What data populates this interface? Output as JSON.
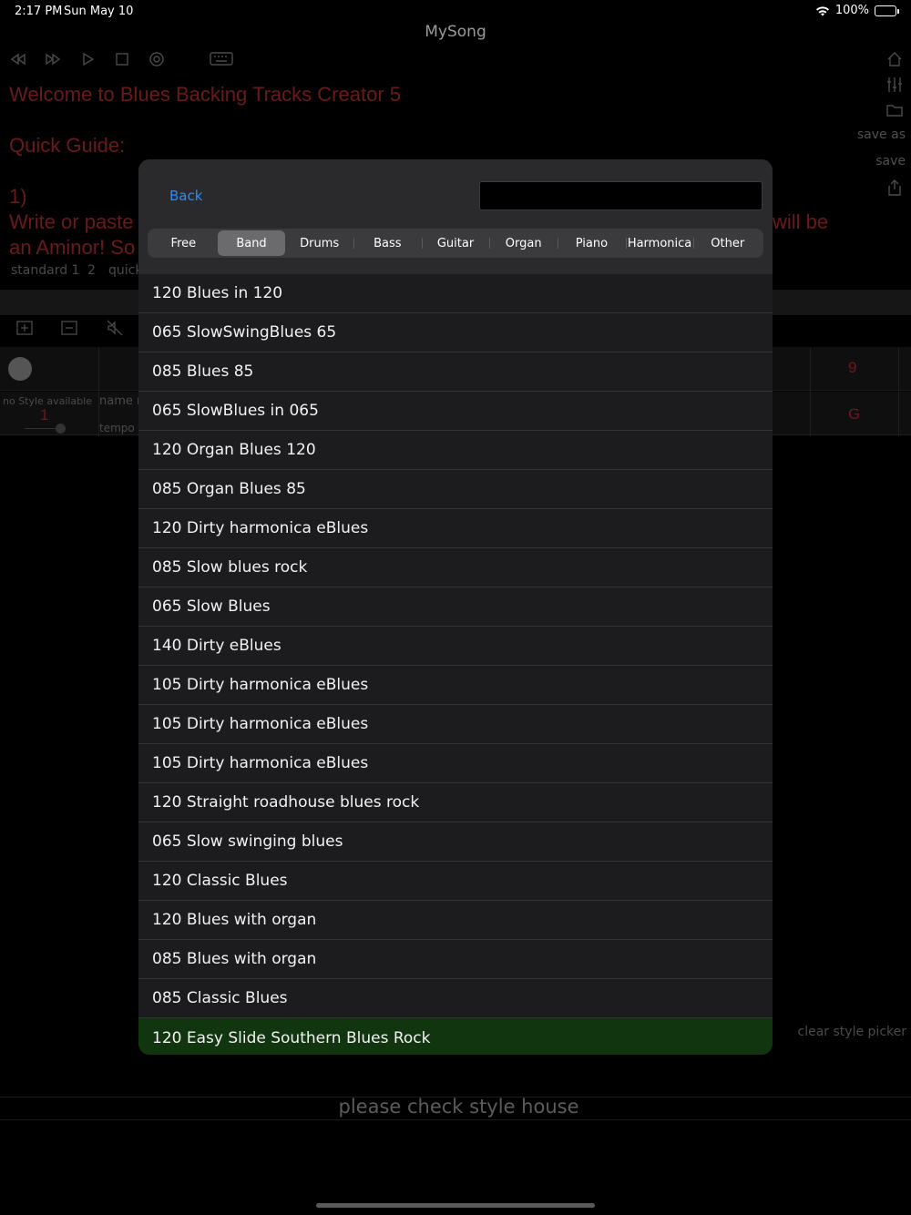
{
  "status_bar": {
    "time": "2:17 PM",
    "date": "Sun May 10",
    "battery": "100%"
  },
  "app": {
    "title": "MySong"
  },
  "background": {
    "welcome": "Welcome to Blues Backing Tracks Creator 5",
    "quick_guide": "Quick Guide:",
    "step": "1)",
    "write_left": "Write or paste",
    "write_right": "will be",
    "aminor": "an Aminor! So",
    "standard_1": "standard 1",
    "standard_2": "2",
    "quick": "quick",
    "save_as": "save as",
    "save": "save",
    "no_style": "no Style available",
    "track_number": "1",
    "name_label": "name n",
    "tempo_label": "tempo r",
    "chord_9": "9",
    "chord_g": "G",
    "clear_style_picker": "clear style picker",
    "bottom_message": "please check style house"
  },
  "picker": {
    "back_label": "Back",
    "search_value": "",
    "segments": [
      "Free",
      "Band",
      "Drums",
      "Bass",
      "Guitar",
      "Organ",
      "Piano",
      "Harmonica",
      "Other"
    ],
    "active_segment": "Band",
    "items": [
      "120 Blues in 120",
      "065 SlowSwingBlues 65",
      "085 Blues 85",
      "065 SlowBlues in 065",
      "120 Organ Blues 120",
      "085 Organ Blues 85",
      "120 Dirty harmonica eBlues",
      "085 Slow blues rock",
      "065 Slow Blues",
      "140 Dirty eBlues",
      "105 Dirty harmonica eBlues",
      "105 Dirty harmonica eBlues",
      "105 Dirty harmonica eBlues",
      "120 Straight roadhouse blues rock",
      "065 Slow swinging blues",
      "120 Classic Blues",
      "120 Blues with organ",
      "085 Blues with organ",
      "085 Classic Blues",
      "120 Easy Slide Southern Blues Rock"
    ],
    "selected_item": "120 Easy Slide Southern Blues Rock"
  },
  "colors": {
    "accent": "#2f8cf5",
    "selected_row": "#11350f",
    "dim_red": "#6b1a1a"
  }
}
